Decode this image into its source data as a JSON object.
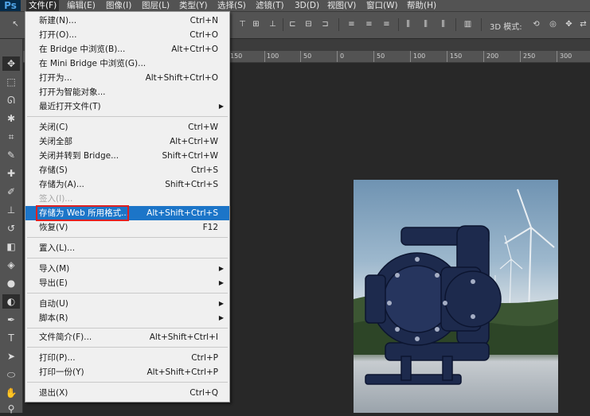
{
  "app": {
    "logo": "Ps"
  },
  "menubar": {
    "items": [
      "文件(F)",
      "编辑(E)",
      "图像(I)",
      "图层(L)",
      "类型(Y)",
      "选择(S)",
      "滤镜(T)",
      "3D(D)",
      "视图(V)",
      "窗口(W)",
      "帮助(H)"
    ]
  },
  "options": {
    "mode_3d": "3D 模式:"
  },
  "ruler": {
    "ticks": [
      "150",
      "100",
      "50",
      "0",
      "50",
      "100",
      "150",
      "200",
      "250",
      "300"
    ]
  },
  "file_menu": {
    "items": [
      {
        "label": "新建(N)...",
        "shortcut": "Ctrl+N"
      },
      {
        "label": "打开(O)...",
        "shortcut": "Ctrl+O"
      },
      {
        "label": "在 Bridge 中浏览(B)...",
        "shortcut": "Alt+Ctrl+O"
      },
      {
        "label": "在 Mini Bridge 中浏览(G)...",
        "shortcut": ""
      },
      {
        "label": "打开为...",
        "shortcut": "Alt+Shift+Ctrl+O"
      },
      {
        "label": "打开为智能对象...",
        "shortcut": ""
      },
      {
        "label": "最近打开文件(T)",
        "shortcut": ""
      },
      {
        "label": "关闭(C)",
        "shortcut": "Ctrl+W"
      },
      {
        "label": "关闭全部",
        "shortcut": "Alt+Ctrl+W"
      },
      {
        "label": "关闭并转到 Bridge...",
        "shortcut": "Shift+Ctrl+W"
      },
      {
        "label": "存储(S)",
        "shortcut": "Ctrl+S"
      },
      {
        "label": "存储为(A)...",
        "shortcut": "Shift+Ctrl+S"
      },
      {
        "label": "签入(I)...",
        "shortcut": ""
      },
      {
        "label": "存储为 Web 所用格式...",
        "shortcut": "Alt+Shift+Ctrl+S"
      },
      {
        "label": "恢复(V)",
        "shortcut": "F12"
      },
      {
        "label": "置入(L)...",
        "shortcut": ""
      },
      {
        "label": "导入(M)",
        "shortcut": ""
      },
      {
        "label": "导出(E)",
        "shortcut": ""
      },
      {
        "label": "自动(U)",
        "shortcut": ""
      },
      {
        "label": "脚本(R)",
        "shortcut": ""
      },
      {
        "label": "文件简介(F)...",
        "shortcut": "Alt+Shift+Ctrl+I"
      },
      {
        "label": "打印(P)...",
        "shortcut": "Ctrl+P"
      },
      {
        "label": "打印一份(Y)",
        "shortcut": "Alt+Shift+Ctrl+P"
      },
      {
        "label": "退出(X)",
        "shortcut": "Ctrl+Q"
      }
    ]
  },
  "colors": {
    "highlight": "#1c75c8",
    "annotation_box": "#e02020"
  }
}
